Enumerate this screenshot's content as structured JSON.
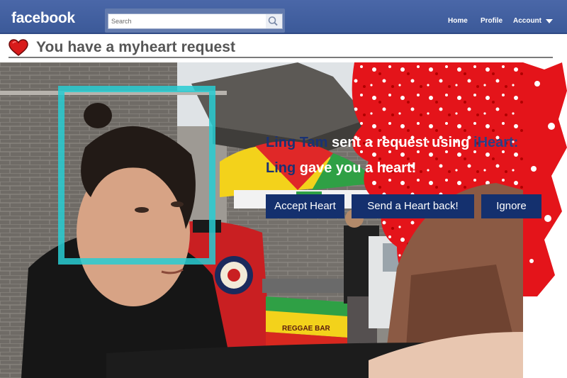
{
  "topbar": {
    "logo": "facebook",
    "search_placeholder": "Search",
    "nav": {
      "home": "Home",
      "profile": "Profile",
      "account": "Account"
    }
  },
  "header": {
    "title": "You have a myheart request"
  },
  "request": {
    "sender": "Ling Tam",
    "text1": " sent a request using ",
    "app": "iHeart:",
    "sender_short": "Ling",
    "text2": " gave you a heart!"
  },
  "buttons": {
    "accept": "Accept Heart",
    "send_back": "Send a Heart back!",
    "ignore": "Ignore"
  },
  "photo": {
    "sign_text": "REGGAE BAR"
  },
  "icons": {
    "heart": "heart-icon",
    "search": "search-icon",
    "caret": "chevron-down-icon",
    "face_box": "face-detection-box"
  },
  "colors": {
    "facebook_blue": "#3b5998",
    "button_navy": "#14306e",
    "heart_red": "#d81b1b",
    "detection_cyan": "#28cdd2"
  }
}
